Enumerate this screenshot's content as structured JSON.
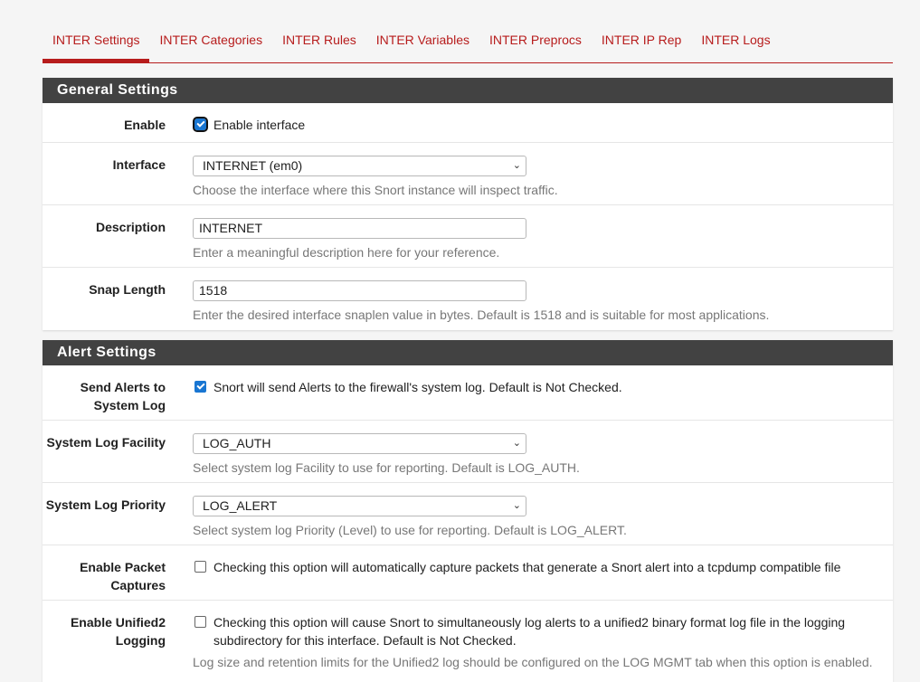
{
  "tabs": [
    {
      "label": "INTER Settings",
      "active": true
    },
    {
      "label": "INTER Categories"
    },
    {
      "label": "INTER Rules"
    },
    {
      "label": "INTER Variables"
    },
    {
      "label": "INTER Preprocs"
    },
    {
      "label": "INTER IP Rep"
    },
    {
      "label": "INTER Logs"
    }
  ],
  "general": {
    "heading": "General Settings",
    "enable": {
      "label": "Enable",
      "checkbox_label": "Enable interface",
      "checked": true
    },
    "interface": {
      "label": "Interface",
      "value": "INTERNET (em0)",
      "help": "Choose the interface where this Snort instance will inspect traffic."
    },
    "description": {
      "label": "Description",
      "value": "INTERNET",
      "help": "Enter a meaningful description here for your reference."
    },
    "snaplen": {
      "label": "Snap Length",
      "value": "1518",
      "help": "Enter the desired interface snaplen value in bytes. Default is 1518 and is suitable for most applications."
    }
  },
  "alert": {
    "heading": "Alert Settings",
    "send_alerts": {
      "label_line1": "Send Alerts to",
      "label_line2": "System Log",
      "checkbox_label": "Snort will send Alerts to the firewall's system log. Default is Not Checked.",
      "checked": true
    },
    "facility": {
      "label": "System Log Facility",
      "value": "LOG_AUTH",
      "help": "Select system log Facility to use for reporting. Default is LOG_AUTH."
    },
    "priority": {
      "label": "System Log Priority",
      "value": "LOG_ALERT",
      "help": "Select system log Priority (Level) to use for reporting. Default is LOG_ALERT."
    },
    "packet_captures": {
      "label_line1": "Enable Packet",
      "label_line2": "Captures",
      "checkbox_label": "Checking this option will automatically capture packets that generate a Snort alert into a tcpdump compatible file",
      "checked": false
    },
    "unified2": {
      "label_line1": "Enable Unified2",
      "label_line2": "Logging",
      "checkbox_label": "Checking this option will cause Snort to simultaneously log alerts to a unified2 binary format log file in the logging subdirectory for this interface. Default is Not Checked.",
      "help": "Log size and retention limits for the Unified2 log should be configured on the LOG MGMT tab when this option is enabled.",
      "checked": false
    }
  },
  "colors": {
    "accent": "#b71c1c",
    "panel_heading": "#424242",
    "checkbox": "#1976d2"
  },
  "icons": {
    "select_arrow": "chevron-down-icon"
  }
}
